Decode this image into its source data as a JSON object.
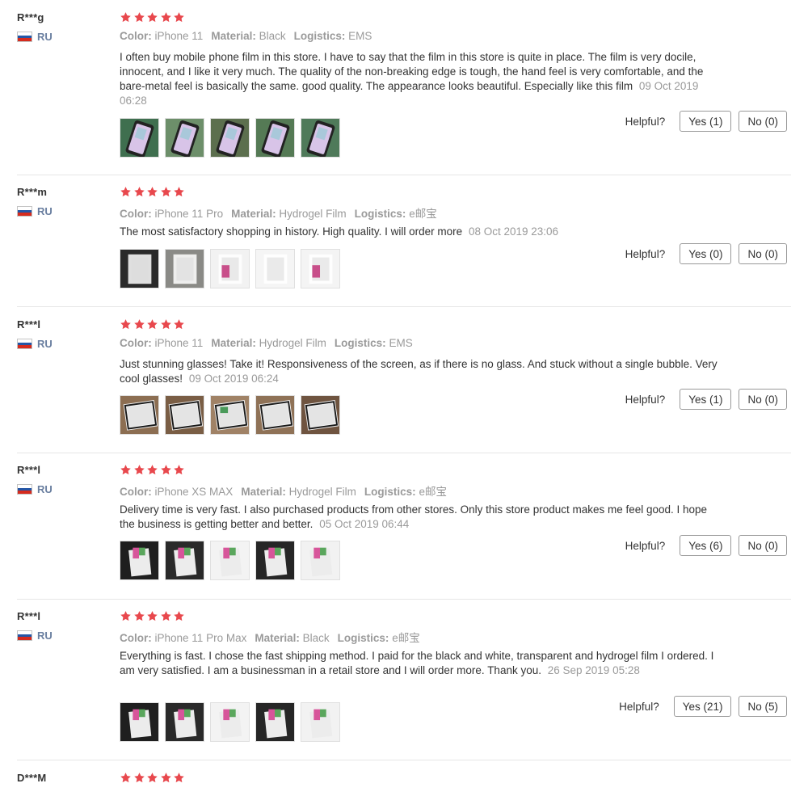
{
  "reviews": [
    {
      "user": "R***g",
      "country": "RU",
      "rating": 5,
      "color_label": "Color:",
      "color": "iPhone 11",
      "material_label": "Material:",
      "material": "Black",
      "logistics_label": "Logistics:",
      "logistics": "EMS",
      "text": "I often buy mobile phone film in this store. I have to say that the film in this store is quite in place. The film is very docile, innocent, and I like it very much. The quality of the non-breaking edge is tough, the hand feel is very comfortable, and the bare-metal feel is basically the same. good quality. The appearance looks beautiful. Especially like this film",
      "date": "09 Oct 2019 06:28",
      "photo_count": 5,
      "photo_style": "green",
      "helpful_label": "Helpful?",
      "yes_label": "Yes (1)",
      "no_label": "No (0)"
    },
    {
      "user": "R***m",
      "country": "RU",
      "rating": 5,
      "color_label": "Color:",
      "color": "iPhone 11 Pro",
      "material_label": "Material:",
      "material": "Hydrogel Film",
      "logistics_label": "Logistics:",
      "logistics": "e邮宝",
      "text": "The most satisfactory shopping in history. High quality. I will order more",
      "date": "08 Oct 2019 23:06",
      "photo_count": 5,
      "photo_style": "film",
      "helpful_label": "Helpful?",
      "yes_label": "Yes (0)",
      "no_label": "No (0)"
    },
    {
      "user": "R***l",
      "country": "RU",
      "rating": 5,
      "color_label": "Color:",
      "color": "iPhone 11",
      "material_label": "Material:",
      "material": "Hydrogel Film",
      "logistics_label": "Logistics:",
      "logistics": "EMS",
      "text": "Just stunning glasses! Take it! Responsiveness of the screen, as if there is no glass. And stuck without a single bubble. Very cool glasses!",
      "date": "09 Oct 2019 06:24",
      "photo_count": 5,
      "photo_style": "wood",
      "helpful_label": "Helpful?",
      "yes_label": "Yes (1)",
      "no_label": "No (0)"
    },
    {
      "user": "R***l",
      "country": "RU",
      "rating": 5,
      "color_label": "Color:",
      "color": "iPhone XS MAX",
      "material_label": "Material:",
      "material": "Hydrogel Film",
      "logistics_label": "Logistics:",
      "logistics": "e邮宝",
      "text": "Delivery time is very fast. I also purchased products from other stores. Only this store product makes me feel good. I hope the business is getting better and better.",
      "date": "05 Oct 2019 06:44",
      "photo_count": 5,
      "photo_style": "pack",
      "helpful_label": "Helpful?",
      "yes_label": "Yes (6)",
      "no_label": "No (0)"
    },
    {
      "user": "R***l",
      "country": "RU",
      "rating": 5,
      "color_label": "Color:",
      "color": "iPhone 11 Pro Max",
      "material_label": "Material:",
      "material": "Black",
      "logistics_label": "Logistics:",
      "logistics": "e邮宝",
      "text": "Everything is fast. I chose the fast shipping method. I paid for the black and white, transparent and hydrogel film I ordered. I am very satisfied. I am a businessman in a retail store and I will order more. Thank you.",
      "date": "26 Sep 2019 05:28",
      "photo_count": 5,
      "photo_style": "pack",
      "helpful_label": "Helpful?",
      "yes_label": "Yes (21)",
      "no_label": "No (5)"
    },
    {
      "user": "D***M",
      "country": "",
      "rating": 5,
      "color_label": "",
      "color": "",
      "material_label": "",
      "material": "",
      "logistics_label": "",
      "logistics": "",
      "text": "",
      "date": "",
      "photo_count": 0,
      "photo_style": "",
      "helpful_label": "",
      "yes_label": "",
      "no_label": ""
    }
  ],
  "colors": {
    "star": "#e8484d",
    "flag_blue": "#2456a6",
    "flag_red": "#d52b1e",
    "divider": "#e6e6e6"
  }
}
